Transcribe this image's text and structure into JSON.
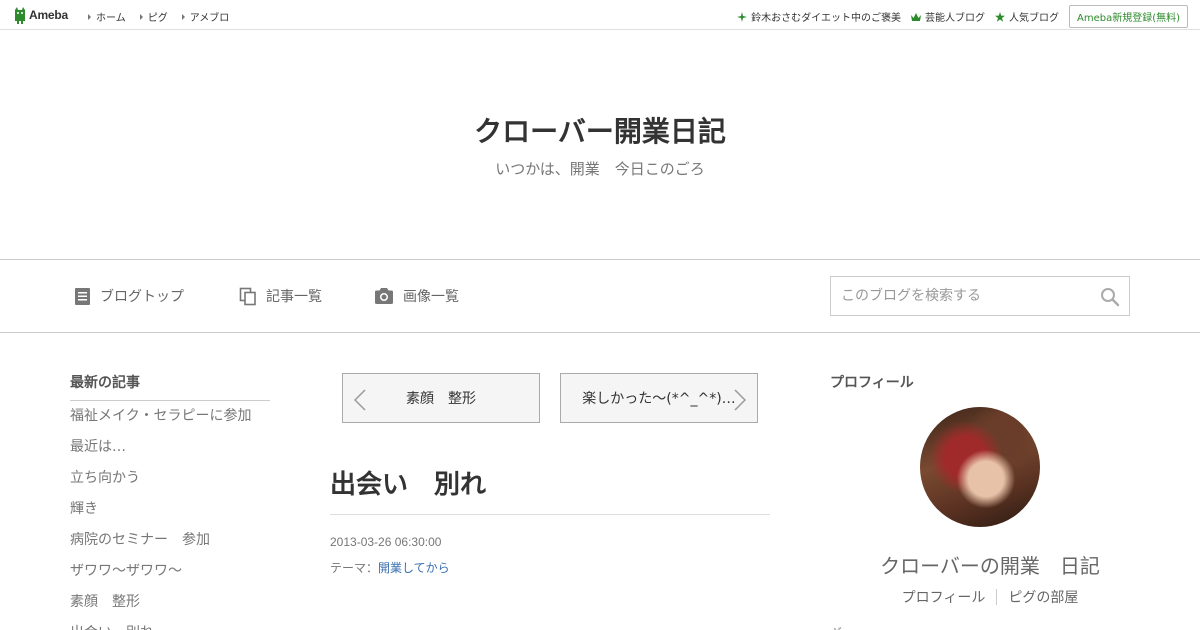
{
  "topbar": {
    "logo_text": "Ameba",
    "nav": [
      "ホーム",
      "ピグ",
      "アメブロ"
    ],
    "right_links": [
      {
        "label": "鈴木おさむダイエット中のご褒美",
        "icon": "sparkle-icon"
      },
      {
        "label": "芸能人ブログ",
        "icon": "crown-icon"
      },
      {
        "label": "人気ブログ",
        "icon": "star-icon"
      }
    ],
    "signup_label": "Ameba新規登録(無料)",
    "accent": "#2d8a2d"
  },
  "header": {
    "title": "クローバー開業日記",
    "subtitle": "いつかは、開業　今日このごろ"
  },
  "nav": {
    "items": [
      {
        "label": "ブログトップ",
        "icon": "document-icon"
      },
      {
        "label": "記事一覧",
        "icon": "copy-icon"
      },
      {
        "label": "画像一覧",
        "icon": "camera-icon"
      }
    ],
    "search_placeholder": "このブログを検索する"
  },
  "sidebar": {
    "title": "最新の記事",
    "items": [
      "福祉メイク・セラピーに参加",
      "最近は…",
      "立ち向かう",
      "輝き",
      "病院のセミナー　参加",
      "ザワワ～ザワワ～",
      "素顔　整形",
      "出会い　別れ"
    ]
  },
  "entry": {
    "prev_label": "素顔　整形",
    "next_label": "楽しかった～(*^_^*)…",
    "title": "出会い　別れ",
    "date": "2013-03-26 06:30:00",
    "theme_prefix": "テーマ：",
    "theme_link": "開業してから",
    "link_color": "#3a6fb0"
  },
  "profile": {
    "section_title": "プロフィール",
    "name": "クローバーの開業　日記",
    "links": [
      "プロフィール",
      "ピグの部屋"
    ],
    "more": "ギ"
  }
}
